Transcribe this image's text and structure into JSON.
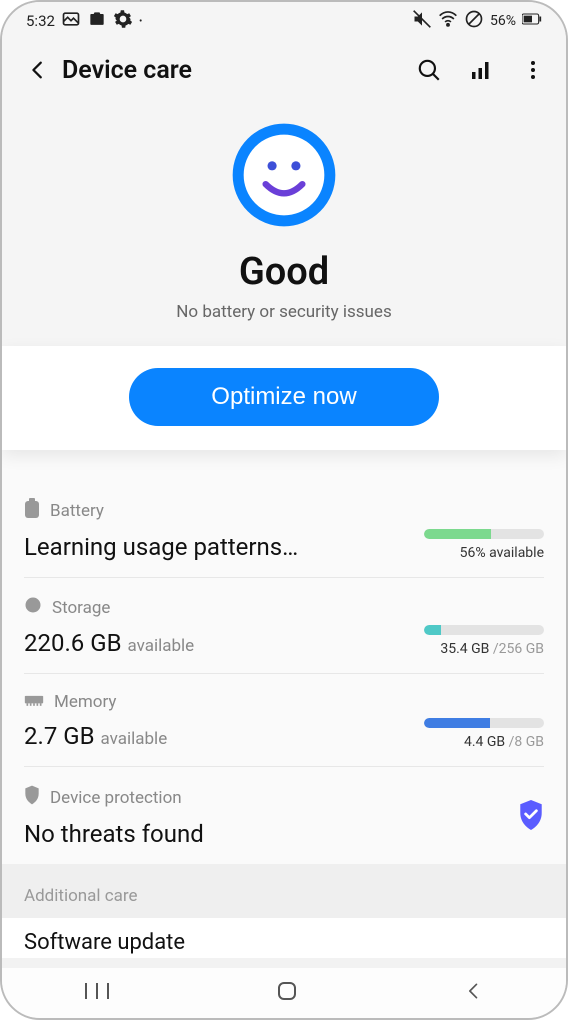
{
  "status_bar": {
    "time": "5:32",
    "battery_percent": "56%"
  },
  "header": {
    "title": "Device care"
  },
  "overview": {
    "status": "Good",
    "subtitle": "No battery or security issues",
    "optimize_button": "Optimize now"
  },
  "battery": {
    "label": "Battery",
    "main": "Learning usage patterns…",
    "sub": "56% available",
    "fill_percent": 56,
    "fill_color": "#7cd98e"
  },
  "storage": {
    "label": "Storage",
    "value": "220.6 GB",
    "suffix": "available",
    "used": "35.4 GB",
    "total": "/256 GB",
    "fill_percent": 14,
    "fill_color": "#4fc9c7"
  },
  "memory": {
    "label": "Memory",
    "value": "2.7 GB",
    "suffix": "available",
    "used": "4.4 GB",
    "total": "/8 GB",
    "fill_percent": 55,
    "fill_color": "#3f7de3"
  },
  "protection": {
    "label": "Device protection",
    "main": "No threats found"
  },
  "additional": {
    "header": "Additional care",
    "software_update": "Software update"
  }
}
